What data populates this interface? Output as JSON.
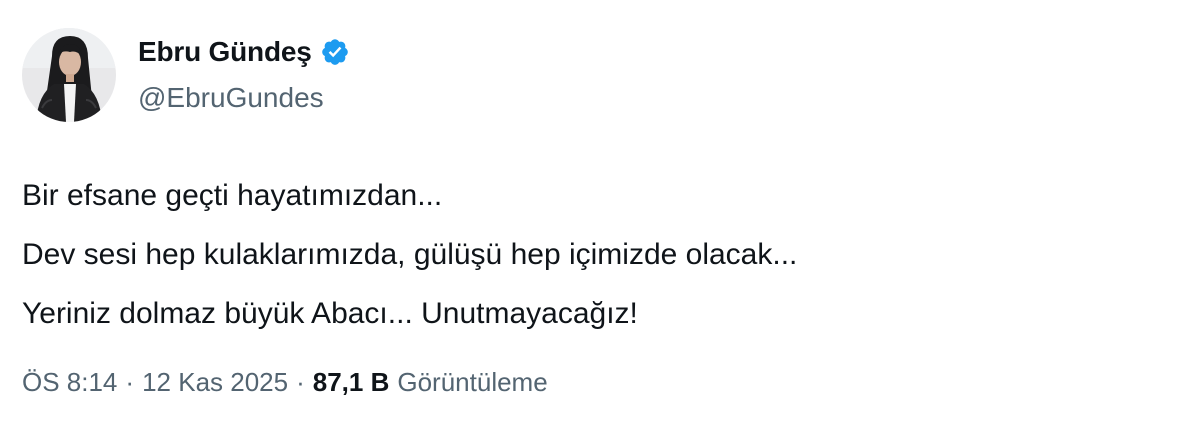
{
  "user": {
    "display_name": "Ebru Gündeş",
    "handle": "@EbruGundes",
    "verified": true,
    "verified_color": "#1d9bf0"
  },
  "tweet": {
    "lines": [
      "Bir efsane geçti hayatımızdan...",
      "Dev sesi hep kulaklarımızda, gülüşü hep içimizde olacak...",
      "Yeriniz dolmaz büyük Abacı... Unutmayacağız!"
    ]
  },
  "meta": {
    "time": "ÖS 8:14",
    "separator": "·",
    "date": "12 Kas 2025",
    "views_count": "87,1 B",
    "views_label": "Görüntüleme"
  },
  "colors": {
    "text_primary": "#0f1419",
    "text_secondary": "#536471"
  }
}
